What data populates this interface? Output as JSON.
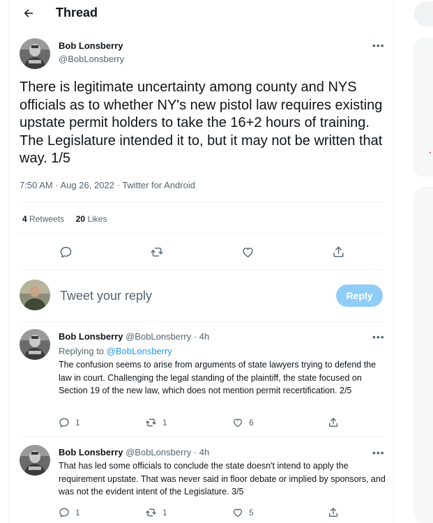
{
  "header": {
    "title": "Thread",
    "back_icon": "arrow-left-icon"
  },
  "main_tweet": {
    "author_name": "Bob Lonsberry",
    "author_handle": "@BobLonsberry",
    "more_icon": "more-icon",
    "text": "There is legitimate uncertainty among county and NYS officials as to whether NY's new pistol law requires existing upstate permit holders to take the 16+2 hours of training. The Legislature intended it to, but it may not be written that way. 1/5",
    "timestamp": "7:50 AM · Aug 26, 2022 · Twitter for Android",
    "retweets_count": "4",
    "retweets_label": "Retweets",
    "likes_count": "20",
    "likes_label": "Likes",
    "actions": [
      "reply-icon",
      "retweet-icon",
      "like-icon",
      "share-icon"
    ]
  },
  "reply_box": {
    "placeholder": "Tweet your reply",
    "button_label": "Reply"
  },
  "replies": [
    {
      "author_name": "Bob Lonsberry",
      "author_handle": "@BobLonsberry",
      "time": "· 4h",
      "replying_prefix": "Replying to",
      "replying_handle": "@BobLonsberry",
      "text": "The confusion seems to arise from arguments of state lawyers trying to defend the law in court. Challenging the legal standing of the plaintiff, the state focused on Section 19 of the new law, which does not mention permit recertification. 2/5",
      "reply_count": "1",
      "retweet_count": "1",
      "like_count": "6"
    },
    {
      "author_name": "Bob Lonsberry",
      "author_handle": "@BobLonsberry",
      "time": "· 4h",
      "text": "That has led some officials to conclude the state doesn't intend to apply the requirement upstate. That was never said in floor debate or implied by sponsors, and was not the evident intent of the Legislature. 3/5",
      "reply_count": "1",
      "retweet_count": "1",
      "like_count": "5"
    }
  ],
  "colors": {
    "accent": "#1d9bf0",
    "reply_button": "#8ecdf8",
    "text": "#0f1419",
    "secondary": "#536471",
    "border": "#eff3f4"
  }
}
